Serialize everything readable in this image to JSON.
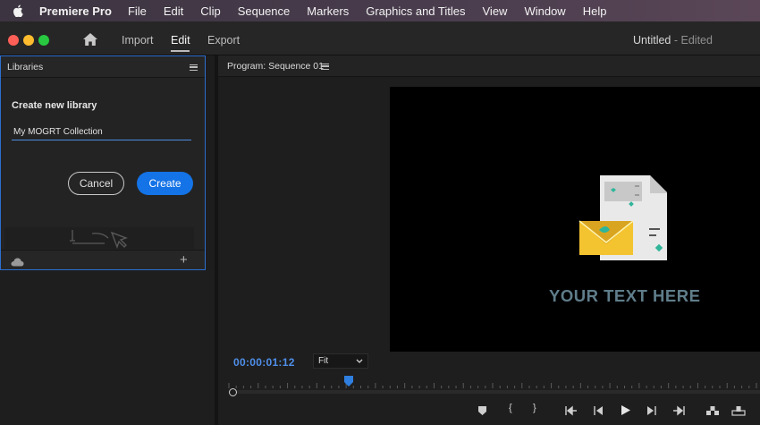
{
  "menubar": {
    "apple_icon": "apple-icon",
    "items": [
      "Premiere Pro",
      "File",
      "Edit",
      "Clip",
      "Sequence",
      "Markers",
      "Graphics and Titles",
      "View",
      "Window",
      "Help"
    ]
  },
  "titlebar": {
    "workspaces": [
      "Import",
      "Edit",
      "Export"
    ],
    "active_workspace": "Edit",
    "doc_title": "Untitled",
    "doc_status": " - Edited"
  },
  "libraries": {
    "title": "Libraries",
    "create_label": "Create new library",
    "input_value": "My MOGRT Collection",
    "cancel_label": "Cancel",
    "create_label_btn": "Create",
    "accent": "#1473e6"
  },
  "monitor": {
    "title": "Program: Sequence 01",
    "overlay_text": "YOUR TEXT HERE",
    "timecode": "00:00:01:12",
    "zoom": "Fit",
    "playhead_fraction": 0.23
  }
}
